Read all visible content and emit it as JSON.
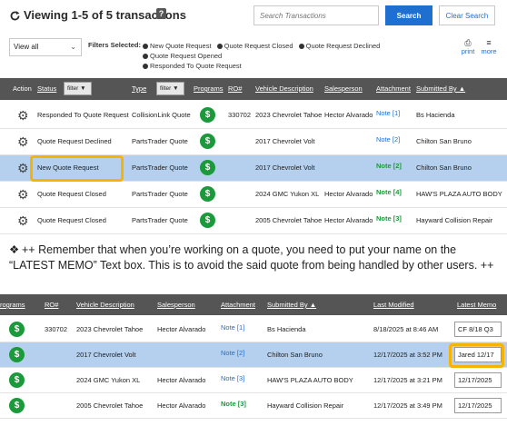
{
  "header": {
    "title": "Viewing 1-5 of 5 transactions",
    "help_glyph": "?",
    "search_placeholder": "Search Transactions",
    "search_label": "Search",
    "clear_label": "Clear Search"
  },
  "filters": {
    "view_value": "View all",
    "label": "Filters Selected:",
    "items": [
      "New Quote Request",
      "Quote Request Closed",
      "Quote Request Declined",
      "Quote Request Opened",
      "Responded To Quote Request"
    ],
    "print_label": "print",
    "more_label": "more"
  },
  "table1": {
    "headers": {
      "action": "Action",
      "status": "Status",
      "status_filter": "filter",
      "type": "Type",
      "type_filter": "filter",
      "programs": "Programs",
      "ro": "RO#",
      "vehicle": "Vehicle Description",
      "salesperson": "Salesperson",
      "attachment": "Attachment",
      "submitted_by": "Submitted By ▲"
    },
    "rows": [
      {
        "status": "Responded To Quote Request",
        "type": "CollisionLink Quote",
        "ro": "330702",
        "vehicle": "2023 Chevrolet Tahoe",
        "salesperson": "Hector Alvarado",
        "attachment": "Note [1]",
        "submitted_by": "Bs Hacienda"
      },
      {
        "status": "Quote Request Declined",
        "type": "PartsTrader Quote",
        "ro": "",
        "vehicle": "2017 Chevrolet Volt",
        "salesperson": "",
        "attachment": "Note [2]",
        "submitted_by": "Chilton San Bruno"
      },
      {
        "status": "New Quote Request",
        "type": "PartsTrader Quote",
        "ro": "",
        "vehicle": "2017 Chevrolet Volt",
        "salesperson": "",
        "attachment": "Note [2]",
        "submitted_by": "Chilton San Bruno"
      },
      {
        "status": "Quote Request Closed",
        "type": "PartsTrader Quote",
        "ro": "",
        "vehicle": "2024 GMC Yukon XL",
        "salesperson": "Hector Alvarado",
        "attachment": "Note [4]",
        "submitted_by": "HAW'S PLAZA AUTO BODY"
      },
      {
        "status": "Quote Request Closed",
        "type": "PartsTrader Quote",
        "ro": "",
        "vehicle": "2005 Chevrolet Tahoe",
        "salesperson": "Hector Alvarado",
        "attachment": "Note [3]",
        "submitted_by": "Hayward Collision Repair"
      }
    ]
  },
  "notice": {
    "text": "++ Remember that when you’re working on a quote, you need to put your name on the “LATEST MEMO” Text box. This is to avoid the said quote from being handled by other users. ++"
  },
  "table2": {
    "headers": {
      "programs": "rograms",
      "ro": "RO#",
      "vehicle": "Vehicle Description",
      "salesperson": "Salesperson",
      "attachment": "Attachment",
      "submitted_by": "Submitted By ▲",
      "last_modified": "Last Modified",
      "latest_memo": "Latest Memo"
    },
    "rows": [
      {
        "ro": "330702",
        "vehicle": "2023 Chevrolet Tahoe",
        "salesperson": "Hector Alvarado",
        "attachment": "Note [1]",
        "submitted_by": "Bs Hacienda",
        "last_modified": "8/18/2025 at 8:46 AM",
        "memo": "CF 8/18 Q3"
      },
      {
        "ro": "",
        "vehicle": "2017 Chevrolet Volt",
        "salesperson": "",
        "attachment": "Note [2]",
        "submitted_by": "Chilton San Bruno",
        "last_modified": "12/17/2025 at 3:52 PM",
        "memo": "Jared 12/17"
      },
      {
        "ro": "",
        "vehicle": "2024 GMC Yukon XL",
        "salesperson": "Hector Alvarado",
        "attachment": "Note [3]",
        "submitted_by": "HAW'S PLAZA AUTO BODY",
        "last_modified": "12/17/2025 at 3:21 PM",
        "memo": "12/17/2025"
      },
      {
        "ro": "",
        "vehicle": "2005 Chevrolet Tahoe",
        "salesperson": "Hector Alvarado",
        "attachment": "Note [3]",
        "submitted_by": "Hayward Collision Repair",
        "last_modified": "12/17/2025 at 3:49 PM",
        "memo": "12/17/2025"
      }
    ]
  },
  "icons": {
    "program": "$",
    "gear": "⚙"
  },
  "colors": {
    "accent": "#1f6fd1",
    "header_bg": "#555555",
    "selected_row": "#b4d0ee",
    "program_green": "#1a9a3a",
    "highlight": "#f5b400"
  }
}
